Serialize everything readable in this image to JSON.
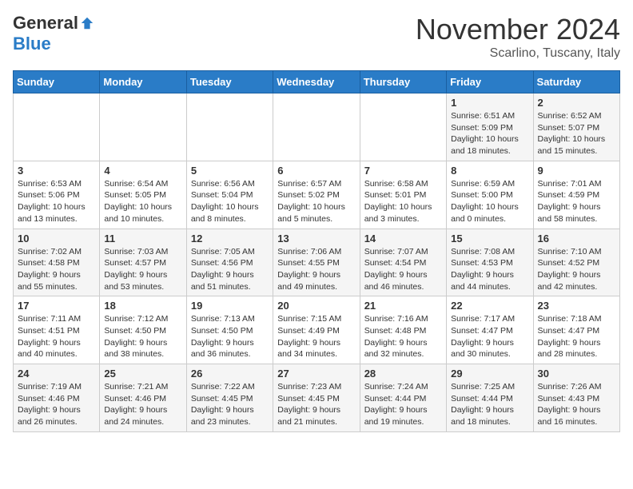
{
  "header": {
    "logo_general": "General",
    "logo_blue": "Blue",
    "month_title": "November 2024",
    "location": "Scarlino, Tuscany, Italy"
  },
  "weekdays": [
    "Sunday",
    "Monday",
    "Tuesday",
    "Wednesday",
    "Thursday",
    "Friday",
    "Saturday"
  ],
  "weeks": [
    [
      {
        "day": "",
        "info": ""
      },
      {
        "day": "",
        "info": ""
      },
      {
        "day": "",
        "info": ""
      },
      {
        "day": "",
        "info": ""
      },
      {
        "day": "",
        "info": ""
      },
      {
        "day": "1",
        "info": "Sunrise: 6:51 AM\nSunset: 5:09 PM\nDaylight: 10 hours\nand 18 minutes."
      },
      {
        "day": "2",
        "info": "Sunrise: 6:52 AM\nSunset: 5:07 PM\nDaylight: 10 hours\nand 15 minutes."
      }
    ],
    [
      {
        "day": "3",
        "info": "Sunrise: 6:53 AM\nSunset: 5:06 PM\nDaylight: 10 hours\nand 13 minutes."
      },
      {
        "day": "4",
        "info": "Sunrise: 6:54 AM\nSunset: 5:05 PM\nDaylight: 10 hours\nand 10 minutes."
      },
      {
        "day": "5",
        "info": "Sunrise: 6:56 AM\nSunset: 5:04 PM\nDaylight: 10 hours\nand 8 minutes."
      },
      {
        "day": "6",
        "info": "Sunrise: 6:57 AM\nSunset: 5:02 PM\nDaylight: 10 hours\nand 5 minutes."
      },
      {
        "day": "7",
        "info": "Sunrise: 6:58 AM\nSunset: 5:01 PM\nDaylight: 10 hours\nand 3 minutes."
      },
      {
        "day": "8",
        "info": "Sunrise: 6:59 AM\nSunset: 5:00 PM\nDaylight: 10 hours\nand 0 minutes."
      },
      {
        "day": "9",
        "info": "Sunrise: 7:01 AM\nSunset: 4:59 PM\nDaylight: 9 hours\nand 58 minutes."
      }
    ],
    [
      {
        "day": "10",
        "info": "Sunrise: 7:02 AM\nSunset: 4:58 PM\nDaylight: 9 hours\nand 55 minutes."
      },
      {
        "day": "11",
        "info": "Sunrise: 7:03 AM\nSunset: 4:57 PM\nDaylight: 9 hours\nand 53 minutes."
      },
      {
        "day": "12",
        "info": "Sunrise: 7:05 AM\nSunset: 4:56 PM\nDaylight: 9 hours\nand 51 minutes."
      },
      {
        "day": "13",
        "info": "Sunrise: 7:06 AM\nSunset: 4:55 PM\nDaylight: 9 hours\nand 49 minutes."
      },
      {
        "day": "14",
        "info": "Sunrise: 7:07 AM\nSunset: 4:54 PM\nDaylight: 9 hours\nand 46 minutes."
      },
      {
        "day": "15",
        "info": "Sunrise: 7:08 AM\nSunset: 4:53 PM\nDaylight: 9 hours\nand 44 minutes."
      },
      {
        "day": "16",
        "info": "Sunrise: 7:10 AM\nSunset: 4:52 PM\nDaylight: 9 hours\nand 42 minutes."
      }
    ],
    [
      {
        "day": "17",
        "info": "Sunrise: 7:11 AM\nSunset: 4:51 PM\nDaylight: 9 hours\nand 40 minutes."
      },
      {
        "day": "18",
        "info": "Sunrise: 7:12 AM\nSunset: 4:50 PM\nDaylight: 9 hours\nand 38 minutes."
      },
      {
        "day": "19",
        "info": "Sunrise: 7:13 AM\nSunset: 4:50 PM\nDaylight: 9 hours\nand 36 minutes."
      },
      {
        "day": "20",
        "info": "Sunrise: 7:15 AM\nSunset: 4:49 PM\nDaylight: 9 hours\nand 34 minutes."
      },
      {
        "day": "21",
        "info": "Sunrise: 7:16 AM\nSunset: 4:48 PM\nDaylight: 9 hours\nand 32 minutes."
      },
      {
        "day": "22",
        "info": "Sunrise: 7:17 AM\nSunset: 4:47 PM\nDaylight: 9 hours\nand 30 minutes."
      },
      {
        "day": "23",
        "info": "Sunrise: 7:18 AM\nSunset: 4:47 PM\nDaylight: 9 hours\nand 28 minutes."
      }
    ],
    [
      {
        "day": "24",
        "info": "Sunrise: 7:19 AM\nSunset: 4:46 PM\nDaylight: 9 hours\nand 26 minutes."
      },
      {
        "day": "25",
        "info": "Sunrise: 7:21 AM\nSunset: 4:46 PM\nDaylight: 9 hours\nand 24 minutes."
      },
      {
        "day": "26",
        "info": "Sunrise: 7:22 AM\nSunset: 4:45 PM\nDaylight: 9 hours\nand 23 minutes."
      },
      {
        "day": "27",
        "info": "Sunrise: 7:23 AM\nSunset: 4:45 PM\nDaylight: 9 hours\nand 21 minutes."
      },
      {
        "day": "28",
        "info": "Sunrise: 7:24 AM\nSunset: 4:44 PM\nDaylight: 9 hours\nand 19 minutes."
      },
      {
        "day": "29",
        "info": "Sunrise: 7:25 AM\nSunset: 4:44 PM\nDaylight: 9 hours\nand 18 minutes."
      },
      {
        "day": "30",
        "info": "Sunrise: 7:26 AM\nSunset: 4:43 PM\nDaylight: 9 hours\nand 16 minutes."
      }
    ]
  ]
}
